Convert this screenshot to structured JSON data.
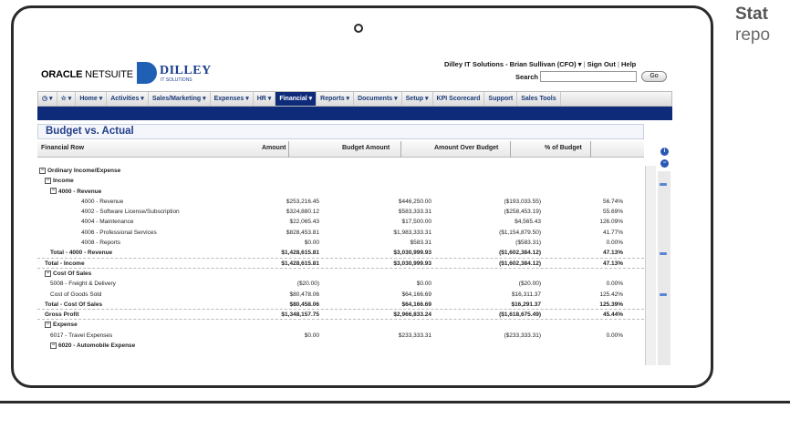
{
  "side_text": {
    "bold": "Stat",
    "rest": "repo"
  },
  "header": {
    "oracle": "ORACLE",
    "netsuite": "NETSUITE",
    "company_name": "DILLEY",
    "company_sub": "IT SOLUTIONS",
    "user_info": "Dilley IT Solutions - Brian Sullivan (CFO)",
    "sign_out": "Sign Out",
    "help": "Help",
    "search_label": "Search",
    "go_label": "Go"
  },
  "nav": [
    "Home ▾",
    "Activities ▾",
    "Sales/Marketing ▾",
    "Expenses ▾",
    "HR ▾",
    "Financial ▾",
    "Reports ▾",
    "Documents ▾",
    "Setup ▾",
    "KPI Scorecard",
    "Support",
    "Sales Tools"
  ],
  "nav_selected": 5,
  "page_title": "Budget vs. Actual",
  "columns": [
    "Financial Row",
    "Amount",
    "Budget Amount",
    "Amount Over Budget",
    "% of Budget"
  ],
  "rows": [
    {
      "label": "Ordinary Income/Expense",
      "level": 0,
      "toggle": true,
      "bold": true,
      "vals": [
        "",
        "",
        "",
        ""
      ]
    },
    {
      "label": "Income",
      "level": 1,
      "toggle": true,
      "bold": true,
      "vals": [
        "",
        "",
        "",
        ""
      ]
    },
    {
      "label": "4000 - Revenue",
      "level": 2,
      "toggle": true,
      "bold": true,
      "vals": [
        "",
        "",
        "",
        ""
      ]
    },
    {
      "label": "4000 - Revenue",
      "level": 3,
      "vals": [
        "$253,216.45",
        "$446,250.00",
        "($193,033.55)",
        "56.74%"
      ]
    },
    {
      "label": "4002 - Software License/Subscription",
      "level": 3,
      "vals": [
        "$324,880.12",
        "$583,333.31",
        "($258,453.19)",
        "55.69%"
      ]
    },
    {
      "label": "4004 - Maintenance",
      "level": 3,
      "vals": [
        "$22,065.43",
        "$17,500.00",
        "$4,565.43",
        "126.09%"
      ]
    },
    {
      "label": "4006 - Professional Services",
      "level": 3,
      "vals": [
        "$828,453.81",
        "$1,983,333.31",
        "($1,154,879.50)",
        "41.77%"
      ]
    },
    {
      "label": "4008 - Reports",
      "level": 3,
      "vals": [
        "$0.00",
        "$583.31",
        "($583.31)",
        "0.00%"
      ]
    },
    {
      "label": "Total - 4000 - Revenue",
      "level": 2,
      "bold": true,
      "total": true,
      "vals": [
        "$1,428,615.81",
        "$3,030,999.93",
        "($1,602,384.12)",
        "47.13%"
      ]
    },
    {
      "label": "Total - Income",
      "level": 1,
      "bold": true,
      "total": true,
      "vals": [
        "$1,428,615.81",
        "$3,030,999.93",
        "($1,602,384.12)",
        "47.13%"
      ]
    },
    {
      "label": "Cost Of Sales",
      "level": 1,
      "toggle": true,
      "bold": true,
      "vals": [
        "",
        "",
        "",
        ""
      ]
    },
    {
      "label": "5008 - Freight & Delivery",
      "level": 2,
      "vals": [
        "($20.00)",
        "$0.00",
        "($20.00)",
        "0.00%"
      ]
    },
    {
      "label": "Cost of Goods Sold",
      "level": 2,
      "vals": [
        "$80,478.06",
        "$64,166.69",
        "$16,311.37",
        "125.42%"
      ]
    },
    {
      "label": "Total - Cost Of Sales",
      "level": 1,
      "bold": true,
      "total": true,
      "vals": [
        "$80,458.06",
        "$64,166.69",
        "$16,291.37",
        "125.39%"
      ]
    },
    {
      "label": "Gross Profit",
      "level": 1,
      "bold": true,
      "total": true,
      "vals": [
        "$1,348,157.75",
        "$2,966,833.24",
        "($1,618,675.49)",
        "45.44%"
      ]
    },
    {
      "label": "Expense",
      "level": 1,
      "toggle": true,
      "bold": true,
      "vals": [
        "",
        "",
        "",
        ""
      ]
    },
    {
      "label": "6017 - Travel Expenses",
      "level": 2,
      "vals": [
        "$0.00",
        "$233,333.31",
        "($233,333.31)",
        "0.00%"
      ]
    },
    {
      "label": "6020 - Automobile Expense",
      "level": 2,
      "toggle": true,
      "bold": true,
      "vals": [
        "",
        "",
        "",
        ""
      ]
    }
  ],
  "colors": {
    "nav_bar": "#0e2b7a",
    "title_text": "#233e8b",
    "accent": "#1f5fb4"
  }
}
